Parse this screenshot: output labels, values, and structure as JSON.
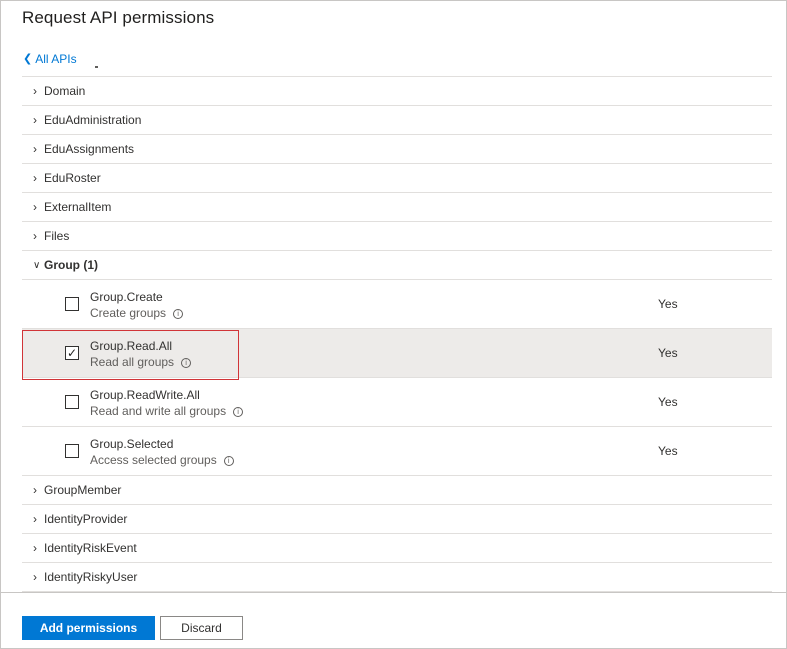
{
  "panel": {
    "title": "Request API permissions",
    "back_link": "All APIs"
  },
  "categories_before": [
    {
      "label": "Domain"
    },
    {
      "label": "EduAdministration"
    },
    {
      "label": "EduAssignments"
    },
    {
      "label": "EduRoster"
    },
    {
      "label": "ExternalItem"
    },
    {
      "label": "Files"
    }
  ],
  "expanded_group": {
    "label": "Group (1)",
    "permissions": [
      {
        "name": "Group.Create",
        "description": "Create groups",
        "admin_consent": "Yes",
        "checked": false
      },
      {
        "name": "Group.Read.All",
        "description": "Read all groups",
        "admin_consent": "Yes",
        "checked": true
      },
      {
        "name": "Group.ReadWrite.All",
        "description": "Read and write all groups",
        "admin_consent": "Yes",
        "checked": false
      },
      {
        "name": "Group.Selected",
        "description": "Access selected groups",
        "admin_consent": "Yes",
        "checked": false
      }
    ]
  },
  "categories_after": [
    {
      "label": "GroupMember"
    },
    {
      "label": "IdentityProvider"
    },
    {
      "label": "IdentityRiskEvent"
    },
    {
      "label": "IdentityRiskyUser"
    }
  ],
  "footer": {
    "add_label": "Add permissions",
    "discard_label": "Discard"
  },
  "colors": {
    "accent": "#0078d4",
    "highlight_border": "#d13438",
    "selected_row": "#edebe9"
  },
  "icons": {
    "collapsed": "chevron-right-icon",
    "expanded": "chevron-down-icon",
    "back": "chevron-left-icon",
    "info": "info-icon",
    "checkmark": "checkmark-icon"
  }
}
